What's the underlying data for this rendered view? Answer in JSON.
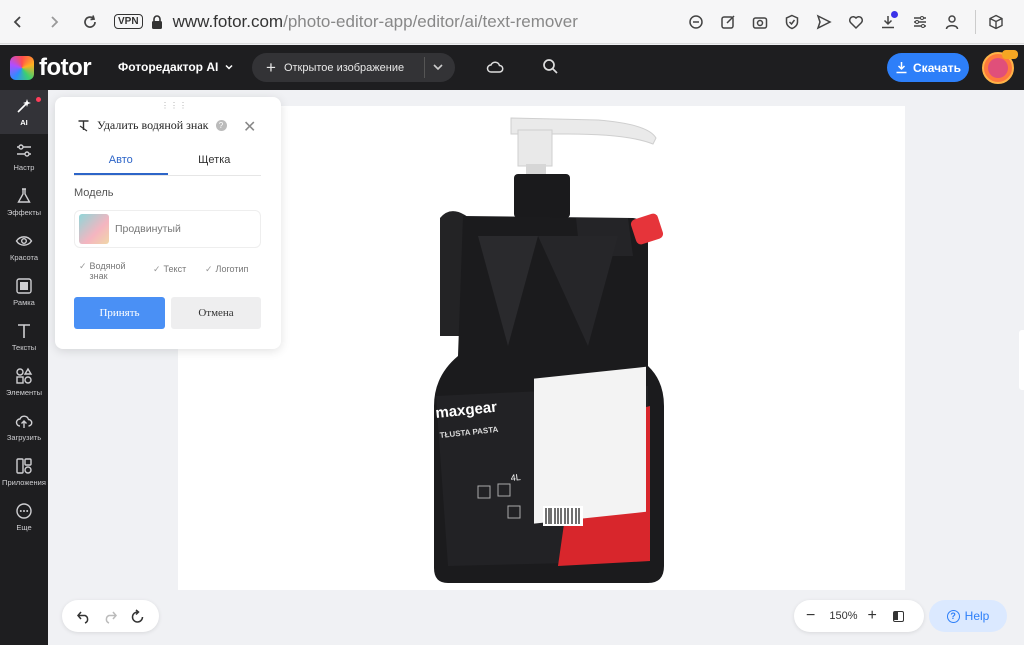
{
  "browser": {
    "vpn_label": "VPN",
    "url_domain": "www.fotor.com",
    "url_path": "/photo-editor-app/editor/ai/text-remover"
  },
  "app": {
    "logo_text": "fotor",
    "editor_menu": "Фоторедактор AI",
    "open_image": "Открытое изображение",
    "download": "Скачать"
  },
  "sidebar": {
    "items": [
      {
        "label": "AI",
        "icon": "ai-sparkle-icon"
      },
      {
        "label": "Настр",
        "icon": "sliders-icon"
      },
      {
        "label": "Эффекты",
        "icon": "flask-icon"
      },
      {
        "label": "Красота",
        "icon": "eye-icon"
      },
      {
        "label": "Рамка",
        "icon": "frame-icon"
      },
      {
        "label": "Тексты",
        "icon": "text-icon"
      },
      {
        "label": "Элементы",
        "icon": "shapes-icon"
      },
      {
        "label": "Загрузить",
        "icon": "cloud-upload-icon"
      },
      {
        "label": "Приложения",
        "icon": "apps-icon"
      },
      {
        "label": "Еще",
        "icon": "more-icon"
      }
    ]
  },
  "panel": {
    "title": "Удалить водяной знак",
    "tabs": [
      "Авто",
      "Щетка"
    ],
    "model_label": "Модель",
    "model_name": "Продвинутый",
    "checks": [
      "Водяной знак",
      "Текст",
      "Логотип"
    ],
    "apply": "Принять",
    "cancel": "Отмена"
  },
  "zoom": {
    "value": "150%"
  },
  "help": {
    "label": "Help"
  },
  "product_image": {
    "brand_text": "maxgear",
    "product_text": "TŁUSTA PASTA",
    "volume": "4L",
    "colors": {
      "body": "#1b1b1d",
      "accent": "#d8262c",
      "cap": "#e6343a"
    }
  }
}
